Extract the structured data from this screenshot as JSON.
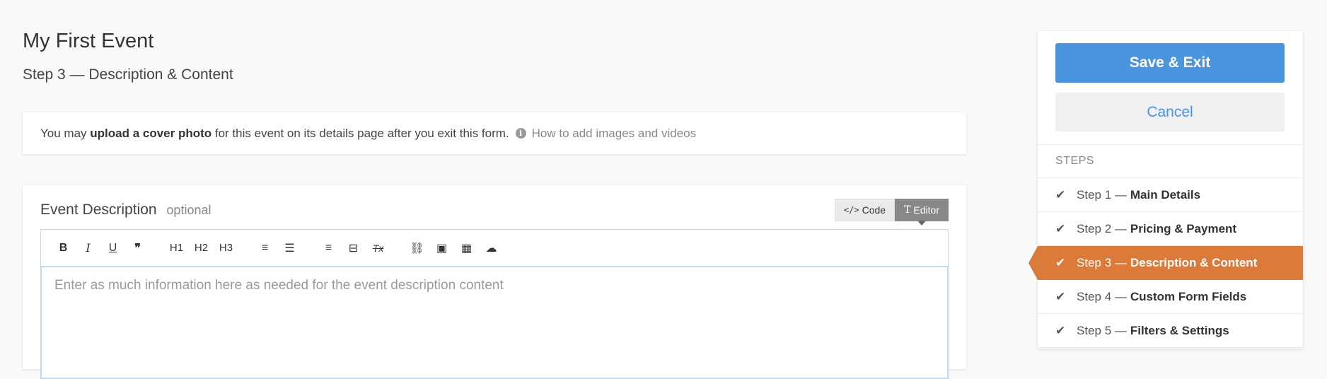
{
  "page": {
    "title": "My First Event",
    "subtitle": "Step 3 — Description & Content"
  },
  "notice": {
    "text_before": "You may ",
    "text_bold": "upload a cover photo",
    "text_after": " for this event on its details page after you exit this form.",
    "help_link": "How to add images and videos"
  },
  "description": {
    "heading": "Event Description",
    "optional": "optional",
    "code_label": "Code",
    "editor_label": "Editor",
    "placeholder": "Enter as much information here as needed for the event description content",
    "toolbar": [
      {
        "name": "bold-icon",
        "glyph": "B"
      },
      {
        "name": "italic-icon",
        "glyph": "I"
      },
      {
        "name": "underline-icon",
        "glyph": "U"
      },
      {
        "name": "quote-icon",
        "glyph": "❞"
      },
      {
        "name": "heading-1-icon",
        "glyph": "H1"
      },
      {
        "name": "heading-2-icon",
        "glyph": "H2"
      },
      {
        "name": "heading-3-icon",
        "glyph": "H3"
      },
      {
        "name": "ordered-list-icon",
        "glyph": "≡"
      },
      {
        "name": "bullet-list-icon",
        "glyph": "☰"
      },
      {
        "name": "align-left-icon",
        "glyph": "≡"
      },
      {
        "name": "horizontal-rule-icon",
        "glyph": "⊟"
      },
      {
        "name": "clear-format-icon",
        "glyph": "Tx"
      },
      {
        "name": "link-icon",
        "glyph": "⛓"
      },
      {
        "name": "image-icon",
        "glyph": "▣"
      },
      {
        "name": "video-icon",
        "glyph": "▦"
      },
      {
        "name": "embed-icon",
        "glyph": "☁"
      }
    ]
  },
  "sidebar": {
    "save_label": "Save & Exit",
    "cancel_label": "Cancel",
    "steps_header": "STEPS",
    "steps": [
      {
        "prefix": "Step 1 —",
        "title": "Main Details"
      },
      {
        "prefix": "Step 2 —",
        "title": "Pricing & Payment"
      },
      {
        "prefix": "Step 3 —",
        "title": "Description & Content",
        "active": true
      },
      {
        "prefix": "Step 4 —",
        "title": "Custom Form Fields"
      },
      {
        "prefix": "Step 5 —",
        "title": "Filters & Settings"
      }
    ]
  },
  "colors": {
    "accent": "#4a94e0",
    "active_step": "#dc7a39"
  }
}
